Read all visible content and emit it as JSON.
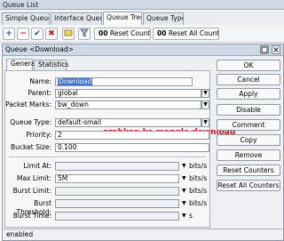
{
  "window": {
    "title": "Queue List"
  },
  "tabs": [
    "Simple Queues",
    "Interface Queues",
    "Queue Tree",
    "Queue Types"
  ],
  "toolbar": {
    "add": "+",
    "remove": "−",
    "enable": "✔",
    "disable": "✖",
    "reset_counters": "Reset Counters",
    "reset_all_counters": "Reset All Counters",
    "counter_glyph": "00"
  },
  "dialog": {
    "title": "Queue <Download>",
    "tabs": [
      "General",
      "Statistics"
    ],
    "fields": {
      "name": {
        "label": "Name:",
        "value": "Download"
      },
      "parent": {
        "label": "Parent:",
        "value": "global"
      },
      "packet_marks": {
        "label": "Packet Marks:",
        "value": "bw_down"
      },
      "queue_type": {
        "label": "Queue Type:",
        "value": "default-small"
      },
      "priority": {
        "label": "Priority:",
        "value": "2"
      },
      "bucket_size": {
        "label": "Bucket Size:",
        "value": "0.100"
      },
      "limit_at": {
        "label": "Limit At:",
        "value": "",
        "unit": "bits/s"
      },
      "max_limit": {
        "label": "Max Limit:",
        "value": "5M",
        "unit": "bits/s"
      },
      "burst_limit": {
        "label": "Burst Limit:",
        "value": "",
        "unit": "bits/s"
      },
      "burst_threshold": {
        "label": "Burst Threshold:",
        "value": "",
        "unit": "bits/s"
      },
      "burst_time": {
        "label": "Burst Time:",
        "value": "",
        "unit": "s"
      }
    },
    "buttons": [
      "OK",
      "Cancel",
      "Apply",
      "Disable",
      "Comment",
      "Copy",
      "Remove",
      "Reset Counters",
      "Reset All Counters"
    ],
    "status": "enabled",
    "annotation": "arahkan ke mangle download"
  },
  "colors": {
    "accent": "#3a6fd8",
    "annotation": "#e0101a",
    "title_bar": "#cfd9e6"
  }
}
